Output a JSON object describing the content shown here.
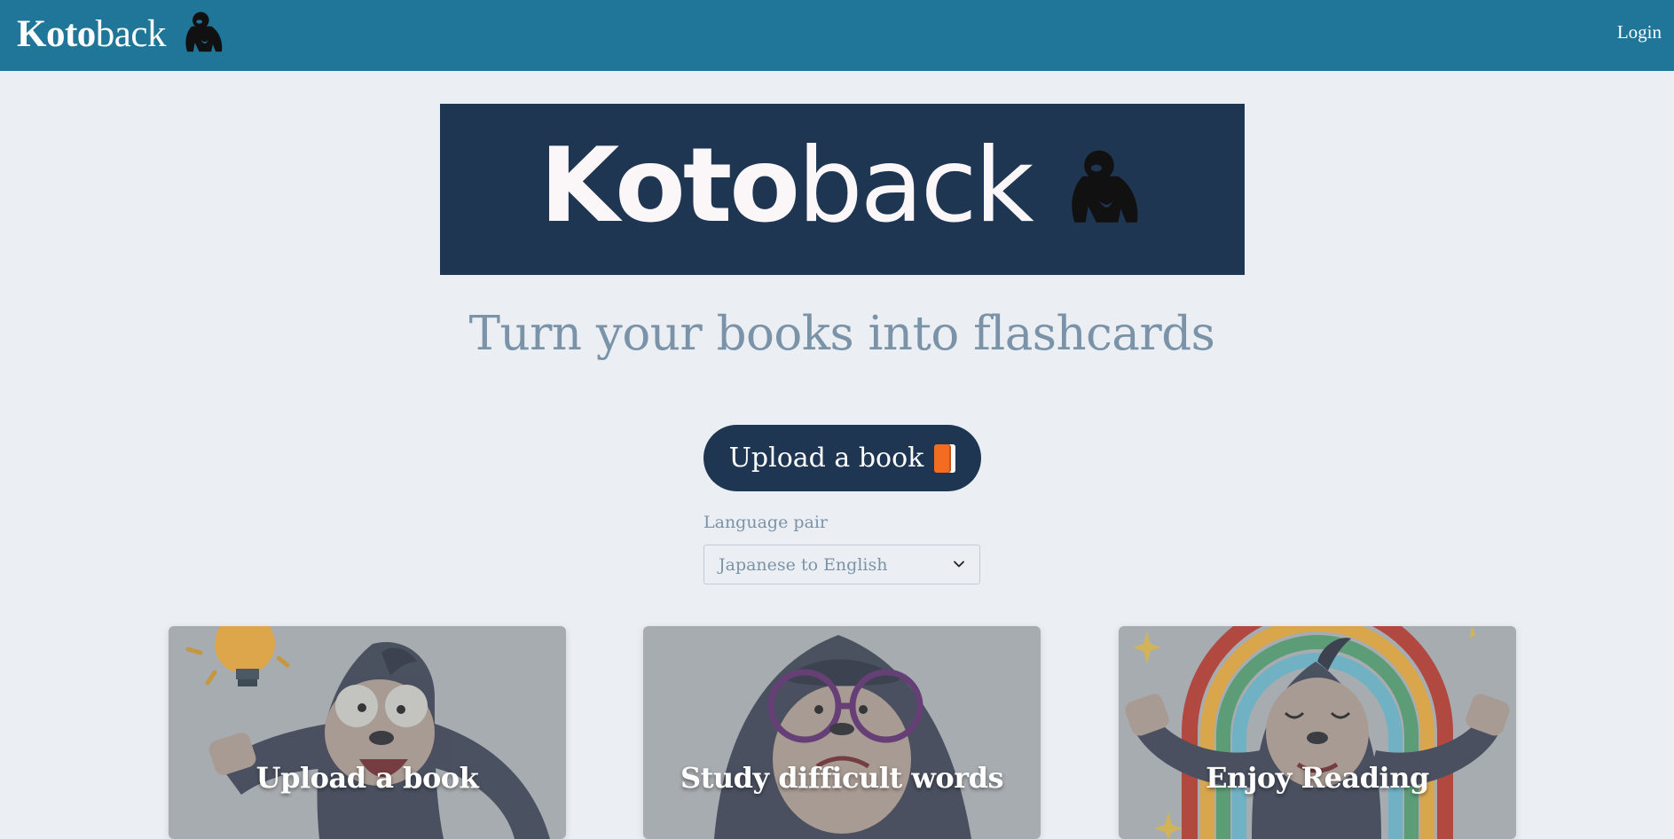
{
  "header": {
    "brand_bold": "Koto",
    "brand_light": "back",
    "brand_icon": "gorilla-icon",
    "login_label": "Login",
    "bg_color": "#1f7699"
  },
  "hero": {
    "banner_bold": "Koto",
    "banner_light": "back",
    "banner_icon": "gorilla-icon",
    "banner_color": "#1f3653",
    "tagline": "Turn your books into flashcards"
  },
  "upload": {
    "button_label": "Upload a book",
    "button_icon": "orange-book-icon"
  },
  "language": {
    "label": "Language pair",
    "selected": "Japanese to English"
  },
  "cards": [
    {
      "title": "Upload a book",
      "illustration": "gorilla-lightbulb-icon"
    },
    {
      "title": "Study difficult words",
      "illustration": "gorilla-glasses-icon"
    },
    {
      "title": "Enjoy Reading",
      "illustration": "gorilla-rainbow-icon"
    }
  ]
}
